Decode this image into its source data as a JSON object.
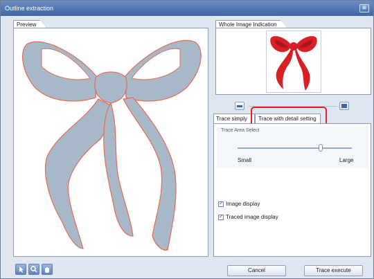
{
  "window": {
    "title": "Outline extraction",
    "close_label": "⊠"
  },
  "preview_tab": "Preview",
  "whole_tab": "Whole Image Indication",
  "tabs": {
    "simple": "Trace simply",
    "detail": "Trace with detail setting"
  },
  "trace_area": {
    "label": "Trace Area Select",
    "min_label": "Small",
    "max_label": "Large",
    "level_fraction": 0.73
  },
  "checkboxes": [
    {
      "label": "Image display",
      "checked": true
    },
    {
      "label": "Traced image display",
      "checked": true
    }
  ],
  "buttons": {
    "cancel": "Cancel",
    "execute": "Trace execute"
  },
  "colors": {
    "highlight": "#e0202a",
    "ribbon_gray": "#a7b8c9",
    "ribbon_red": "#d81f26"
  }
}
